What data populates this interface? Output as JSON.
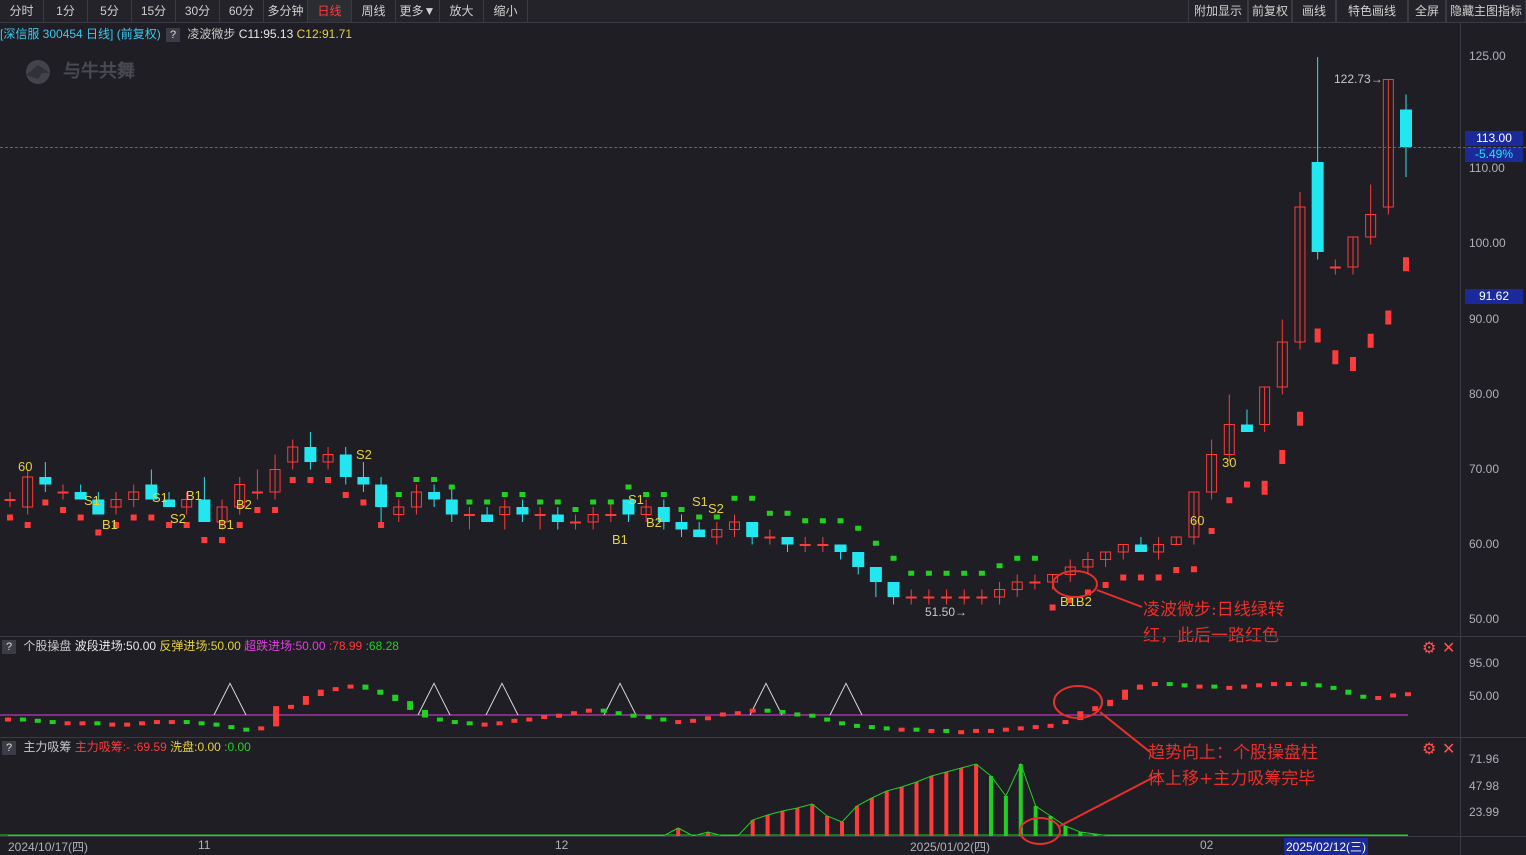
{
  "toolbar": {
    "left": [
      "分时",
      "1分",
      "5分",
      "15分",
      "30分",
      "60分",
      "多分钟",
      "日线",
      "周线",
      "更多▼",
      "放大",
      "缩小"
    ],
    "active": "日线",
    "right": [
      "附加显示",
      "前复权",
      "画线",
      "特色画线",
      "全屏",
      "隐藏主图指标"
    ]
  },
  "main_info": {
    "stock": "[深信服 300454 日线]",
    "adjust": "(前复权)",
    "qmark": "?",
    "indicator": "凌波微步",
    "c11": "C11:95.13",
    "c12": "C12:91.71"
  },
  "price_axis": [
    "125.00",
    "110.00",
    "100.00",
    "90.00",
    "80.00",
    "70.00",
    "60.00",
    "50.00"
  ],
  "price_tags": {
    "current": "113.00",
    "pct": "-5.49%",
    "line": "91.62"
  },
  "high_label": "122.73",
  "low_label": "51.50",
  "logo_text": "与牛共舞",
  "signals": [
    "60",
    "S1",
    "B1",
    "S1",
    "S2",
    "B1",
    "B1",
    "B2",
    "S2",
    "S1",
    "B2",
    "B1",
    "S1",
    "S2",
    "B1B2",
    "60",
    "30"
  ],
  "panel2": {
    "qmark": "?",
    "name": "个股操盘",
    "f1": "波段进场:50.00",
    "f2": "反弹进场:50.00",
    "f3": "超跌进场:50.00",
    "f4": ":78.99",
    "f5": ":68.28",
    "axis": [
      "95.00",
      "50.00"
    ]
  },
  "panel3": {
    "qmark": "?",
    "name": "主力吸筹",
    "f1": "主力吸筹:-",
    "f2": ":69.59",
    "f3": "洗盘:0.00",
    "f4": ":0.00",
    "axis": [
      "71.96",
      "47.98",
      "23.99"
    ]
  },
  "dates": [
    "2024/10/17(四)",
    "11",
    "12",
    "2025/01/02(四)",
    "02",
    "2025/02/12(三)"
  ],
  "annotations": {
    "a1": "凌波微步:日线绿转\n红，此后一路红色",
    "a2": "趋势向上：个股操盘柱\n体上移+主力吸筹完毕"
  },
  "colors": {
    "up": "#ff3b3b",
    "down": "#22e6f0",
    "green": "#22d022",
    "yellow": "#e6d23a",
    "magenta": "#e040e0",
    "accent": "#e8302a"
  },
  "chart_data": [
    {
      "type": "candlestick",
      "title": "深信服 300454 日线",
      "ylim": [
        48,
        127
      ],
      "candles": [
        [
          66,
          67,
          65,
          66
        ],
        [
          65,
          70,
          64,
          69
        ],
        [
          69,
          71,
          67,
          68
        ],
        [
          67,
          68,
          66,
          67
        ],
        [
          67,
          68,
          66,
          66
        ],
        [
          66,
          67,
          64,
          64
        ],
        [
          65,
          67,
          64,
          66
        ],
        [
          66,
          68,
          65,
          67
        ],
        [
          68,
          70,
          66,
          66
        ],
        [
          66,
          67,
          65,
          65
        ],
        [
          65,
          67,
          64,
          66
        ],
        [
          66,
          69,
          63,
          63
        ],
        [
          63,
          66,
          62,
          65
        ],
        [
          65,
          69,
          64,
          68
        ],
        [
          67,
          70,
          66,
          67
        ],
        [
          67,
          72,
          66,
          70
        ],
        [
          71,
          74,
          70,
          73
        ],
        [
          73,
          75,
          70,
          71
        ],
        [
          71,
          73,
          70,
          72
        ],
        [
          72,
          73,
          68,
          69
        ],
        [
          69,
          71,
          67,
          68
        ],
        [
          68,
          69,
          63,
          65
        ],
        [
          64,
          66,
          63,
          65
        ],
        [
          65,
          68,
          64,
          67
        ],
        [
          67,
          68,
          65,
          66
        ],
        [
          66,
          68,
          63,
          64
        ],
        [
          64,
          65,
          62,
          64
        ],
        [
          64,
          65,
          63,
          63
        ],
        [
          64,
          66,
          62,
          65
        ],
        [
          65,
          66,
          63,
          64
        ],
        [
          64,
          65,
          62,
          64
        ],
        [
          64,
          65,
          62,
          63
        ],
        [
          63,
          64,
          62,
          63
        ],
        [
          63,
          65,
          62,
          64
        ],
        [
          64,
          66,
          63,
          64
        ],
        [
          66,
          66,
          63,
          64
        ],
        [
          64,
          66,
          63,
          65
        ],
        [
          65,
          66,
          62,
          63
        ],
        [
          63,
          64,
          61,
          62
        ],
        [
          62,
          63,
          61,
          61
        ],
        [
          61,
          63,
          60,
          62
        ],
        [
          62,
          64,
          61,
          63
        ],
        [
          63,
          63,
          60,
          61
        ],
        [
          61,
          62,
          60,
          61
        ],
        [
          61,
          61,
          59,
          60
        ],
        [
          60,
          61,
          59,
          60
        ],
        [
          60,
          61,
          59,
          60
        ],
        [
          60,
          60,
          58,
          59
        ],
        [
          59,
          59,
          56,
          57
        ],
        [
          57,
          57,
          53,
          55
        ],
        [
          55,
          55,
          52,
          53
        ],
        [
          53,
          54,
          52,
          53
        ],
        [
          53,
          54,
          52,
          53
        ],
        [
          53,
          54,
          52,
          53
        ],
        [
          53,
          54,
          52,
          53
        ],
        [
          53,
          54,
          52,
          53
        ],
        [
          53,
          55,
          52,
          54
        ],
        [
          54,
          56,
          53,
          55
        ],
        [
          55,
          56,
          54,
          55
        ],
        [
          55,
          56,
          54,
          56
        ],
        [
          56,
          58,
          55,
          57
        ],
        [
          57,
          59,
          56,
          58
        ],
        [
          58,
          59,
          57,
          59
        ],
        [
          59,
          60,
          58,
          60
        ],
        [
          60,
          61,
          59,
          59
        ],
        [
          59,
          61,
          58,
          60
        ],
        [
          60,
          61,
          60,
          61
        ],
        [
          61,
          67,
          60,
          67
        ],
        [
          67,
          74,
          66,
          72
        ],
        [
          72,
          80,
          71,
          76
        ],
        [
          76,
          78,
          75,
          75
        ],
        [
          76,
          81,
          75,
          81
        ],
        [
          81,
          90,
          80,
          87
        ],
        [
          87,
          107,
          86,
          105
        ],
        [
          111,
          125,
          98,
          99
        ],
        [
          97,
          98,
          96,
          97
        ],
        [
          97,
          101,
          96,
          101
        ],
        [
          101,
          108,
          100,
          104
        ],
        [
          105,
          122,
          104,
          122
        ],
        [
          118,
          120,
          109,
          113
        ]
      ],
      "line_ylim": [
        48,
        127
      ],
      "series_dots_green_to_red": "凌波微步"
    },
    {
      "type": "bar",
      "title": "个股操盘",
      "ylim": [
        35,
        100
      ],
      "values": [
        48,
        47,
        46,
        45,
        45,
        45,
        44,
        44,
        44,
        45,
        46,
        46,
        45,
        44,
        42,
        40,
        39,
        41,
        57,
        58,
        65,
        70,
        72,
        74,
        70,
        66,
        61,
        54,
        48,
        46,
        45,
        44,
        44,
        45,
        47,
        48,
        50,
        51,
        53,
        55,
        53,
        51,
        50,
        48,
        46,
        46,
        47,
        49,
        52,
        53,
        55,
        54,
        52,
        51,
        48,
        45,
        43,
        42,
        41,
        40,
        40,
        39,
        39,
        38,
        38,
        39,
        39,
        40,
        41,
        42,
        43,
        46,
        53,
        57,
        62,
        70,
        74,
        76,
        75,
        74,
        74,
        73,
        73,
        74,
        75,
        76,
        76,
        75,
        73,
        70,
        66,
        64,
        65,
        67,
        68
      ],
      "ref_line": 50
    },
    {
      "type": "bar",
      "title": "主力吸筹",
      "ylim": [
        0,
        78
      ],
      "values": [
        0,
        0,
        0,
        0,
        0,
        0,
        0,
        0,
        0,
        0,
        0,
        0,
        0,
        0,
        0,
        0,
        0,
        0,
        0,
        0,
        0,
        0,
        0,
        0,
        0,
        0,
        0,
        0,
        0,
        0,
        0,
        0,
        0,
        0,
        0,
        0,
        0,
        0,
        0,
        0,
        0,
        0,
        0,
        0,
        0,
        8,
        0,
        4,
        0,
        0,
        16,
        21,
        25,
        28,
        32,
        20,
        14,
        30,
        38,
        45,
        49,
        54,
        60,
        64,
        68,
        72,
        60,
        40,
        72,
        30,
        20,
        10,
        4,
        2,
        0,
        0,
        0,
        0,
        0,
        0,
        0,
        0,
        0,
        0,
        0,
        0,
        0,
        0,
        0,
        0,
        0,
        0,
        0,
        0,
        0
      ]
    }
  ]
}
